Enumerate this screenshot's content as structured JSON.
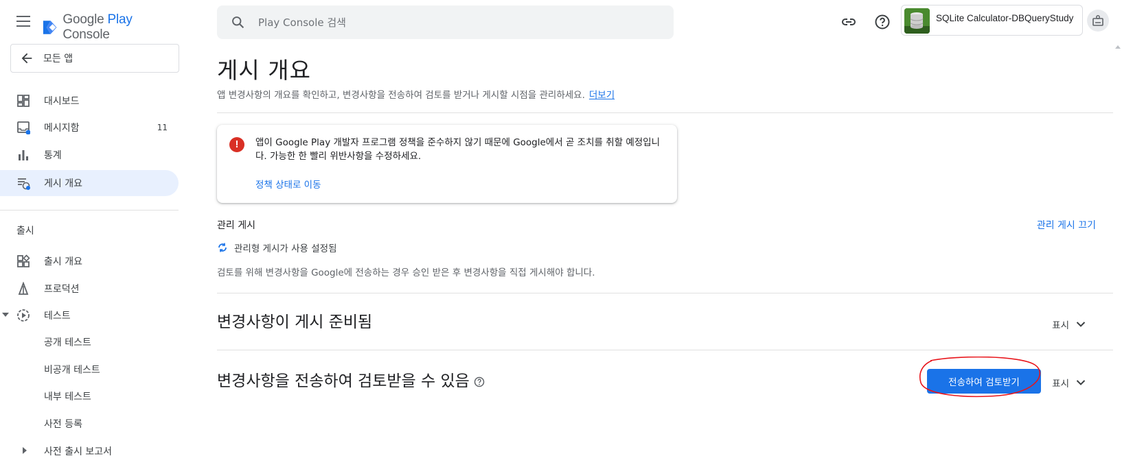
{
  "brand": {
    "part1": "Google ",
    "part2": "Play",
    "part3": " Console"
  },
  "sidebar": {
    "all_apps": "모든 앱",
    "items": [
      {
        "label": "대시보드"
      },
      {
        "label": "메시지함",
        "count": "11"
      },
      {
        "label": "통계"
      },
      {
        "label": "게시 개요"
      }
    ],
    "section_title": "출시",
    "release_items": [
      {
        "label": "출시 개요"
      },
      {
        "label": "프로덕션"
      },
      {
        "label": "테스트"
      },
      {
        "label": "공개 테스트"
      },
      {
        "label": "비공개 테스트"
      },
      {
        "label": "내부 테스트"
      },
      {
        "label": "사전 등록"
      },
      {
        "label": "사전 출시 보고서"
      }
    ]
  },
  "header": {
    "search_placeholder": "Play Console 검색",
    "app_name": "SQLite Calculator-DBQueryStudy"
  },
  "main": {
    "title": "게시 개요",
    "description": "앱 변경사항의 개요를 확인하고, 변경사항을 전송하여 검토를 받거나 게시할 시점을 관리하세요.",
    "learn_more": "더보기",
    "alert": {
      "text": "앱이 Google Play 개발자 프로그램 정책을 준수하지 않기 때문에 Google에서 곧 조치를 취할 예정입니다. 가능한 한 빨리 위반사항을 수정하세요.",
      "link": "정책 상태로 이동"
    },
    "managed": {
      "title": "관리 게시",
      "turn_off": "관리 게시 끄기",
      "status": "관리형 게시가 사용 설정됨",
      "note": "검토를 위해 변경사항을 Google에 전송하는 경우 승인 받은 후 변경사항을 직접 게시해야 합니다."
    },
    "ready_section": {
      "title": "변경사항이 게시 준비됨",
      "show": "표시"
    },
    "review_section": {
      "title": "변경사항을 전송하여 검토받을 수 있음",
      "show": "표시",
      "button": "전송하여 검토받기"
    }
  },
  "colors": {
    "accent": "#1a73e8",
    "error": "#d93025",
    "active_bg": "#e8f0fe",
    "annotation": "#e8141a"
  }
}
